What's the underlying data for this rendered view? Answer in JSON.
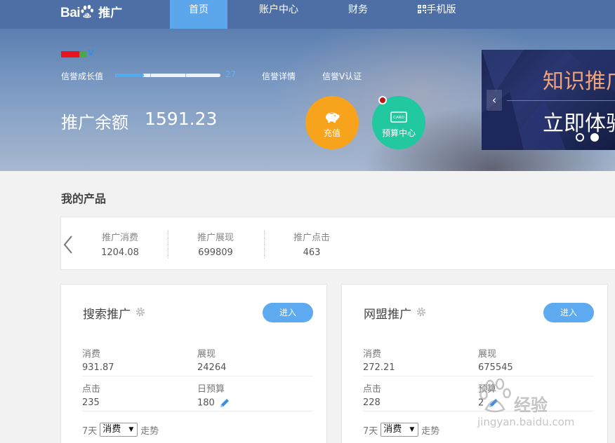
{
  "nav": {
    "logo_bai": "Bai",
    "logo_du": "du",
    "logo_tg": "推广",
    "items": [
      {
        "label": "首页"
      },
      {
        "label": "账户中心"
      },
      {
        "label": "财务"
      },
      {
        "label": "手机版"
      }
    ]
  },
  "banner": {
    "user_badge": "V",
    "credit_label": "信誉成长值",
    "credit_value": "27",
    "credit_progress": 0.27,
    "credit_detail": "信誉详情",
    "credit_verify": "信誉V认证",
    "balance_label": "推广余额",
    "balance_value": "1591.23",
    "recharge_label": "充值",
    "budget_label": "预算中心",
    "budget_card_text": "CARD",
    "promo_line1": "知识推广",
    "promo_line2": "立即体验",
    "promo_prev": "‹"
  },
  "products": {
    "title": "我的产品",
    "metrics": [
      {
        "label": "推广消费",
        "value": "1204.08"
      },
      {
        "label": "推广展现",
        "value": "699809"
      },
      {
        "label": "推广点击",
        "value": "463"
      }
    ]
  },
  "cards": [
    {
      "title": "搜索推广",
      "enter": "进入",
      "stats": [
        {
          "label": "消费",
          "value": "931.87"
        },
        {
          "label": "展现",
          "value": "24264"
        },
        {
          "label": "点击",
          "value": "235"
        },
        {
          "label": "日预算",
          "value": "180"
        }
      ],
      "trend_prefix": "7天",
      "trend_select": "消费",
      "trend_suffix": "走势"
    },
    {
      "title": "网盟推广",
      "enter": "进入",
      "stats": [
        {
          "label": "消费",
          "value": "272.21"
        },
        {
          "label": "展现",
          "value": "675545"
        },
        {
          "label": "点击",
          "value": "228"
        },
        {
          "label": "预算",
          "value": "2"
        }
      ],
      "trend_prefix": "7天",
      "trend_select": "消费",
      "trend_suffix": "走势"
    }
  ],
  "watermark": {
    "text": "经验",
    "url": "jingyan.baidu.com"
  }
}
